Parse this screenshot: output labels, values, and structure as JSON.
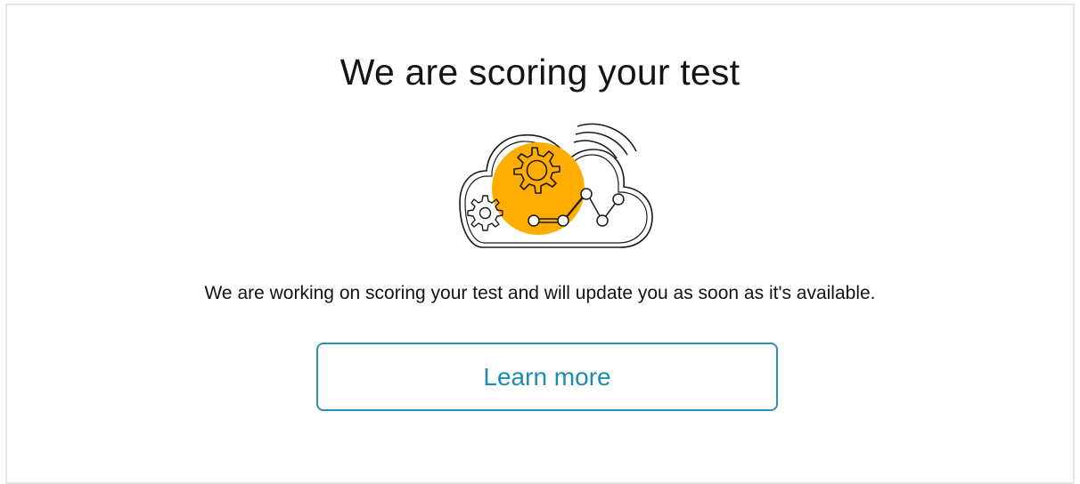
{
  "scoring": {
    "title": "We are scoring your test",
    "message": "We are working on scoring your test and will update you as soon as it's available.",
    "learn_more_label": "Learn more",
    "illustration_icon": "cloud-gears-chart-illustration"
  },
  "colors": {
    "accent": "#1f8cad",
    "illustration_highlight": "#ffae00",
    "text": "#141414",
    "card_border": "#e6e6e6"
  }
}
